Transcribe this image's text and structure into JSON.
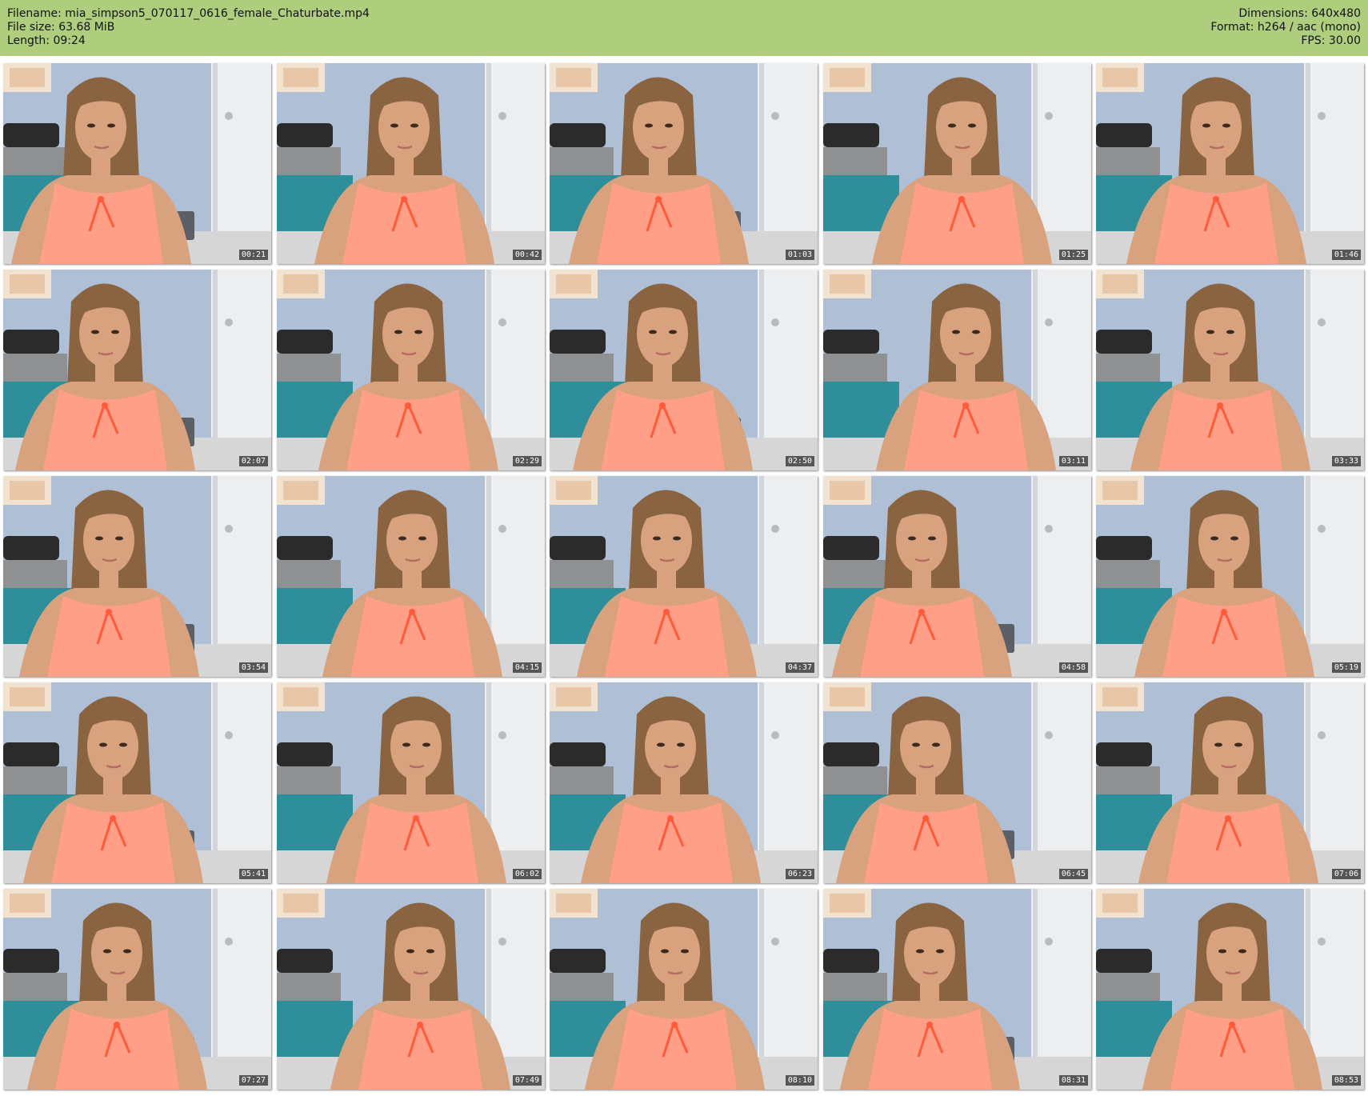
{
  "header": {
    "left": [
      "Filename: mia_simpson5_070117_0616_female_Chaturbate.mp4",
      "File size: 63.68 MiB",
      "Length: 09:24"
    ],
    "right": [
      "Dimensions: 640x480",
      "Format: h264 / aac (mono)",
      "FPS: 30.00"
    ]
  },
  "grid": {
    "columns": 5,
    "rows": 5,
    "timestamps": [
      "00:21",
      "00:42",
      "01:03",
      "01:25",
      "01:46",
      "02:07",
      "02:29",
      "02:50",
      "03:11",
      "03:33",
      "03:54",
      "04:15",
      "04:37",
      "04:58",
      "05:19",
      "05:41",
      "06:02",
      "06:23",
      "06:45",
      "07:06",
      "07:27",
      "07:49",
      "08:10",
      "08:31",
      "08:53"
    ]
  },
  "colors": {
    "header_bg": "#aecd7d",
    "wall": "#aebfd6",
    "door": "#eceef0",
    "top": "#ff9f87",
    "bow": "#ff5a3a",
    "hair": "#8a6440",
    "skin": "#d9a27e",
    "bedding": "#2e8f9a"
  }
}
